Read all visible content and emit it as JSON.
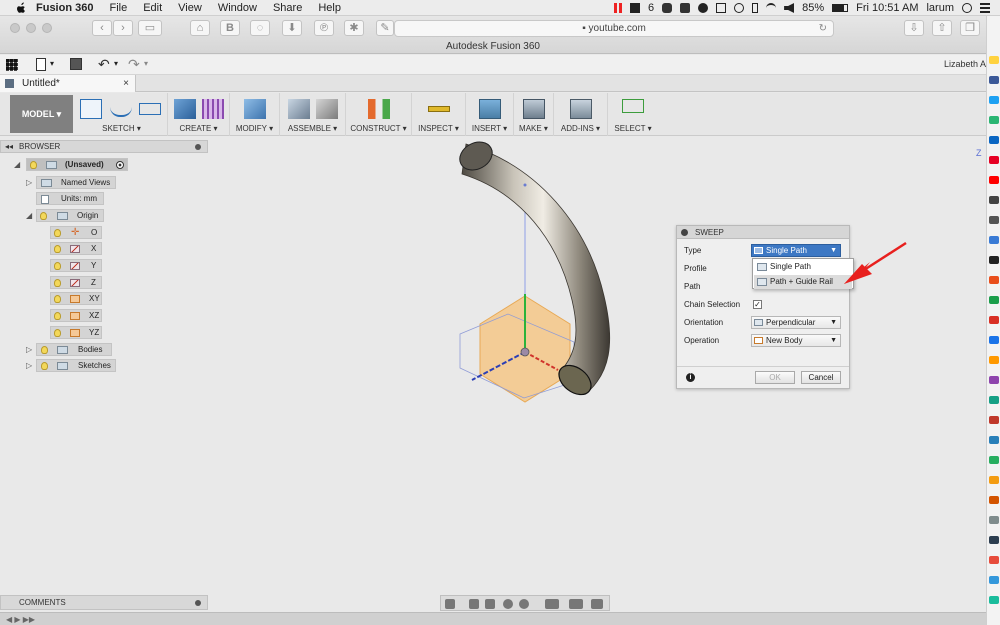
{
  "menubar": {
    "app_name": "Fusion 360",
    "menus": [
      "File",
      "Edit",
      "View",
      "Window",
      "Share",
      "Help"
    ],
    "notification_count": "6",
    "battery": "85%",
    "clock": "Fri 10:51 AM",
    "user": "larum"
  },
  "safari": {
    "url": "youtube.com",
    "window_title": "Autodesk Fusion 360"
  },
  "appbar": {
    "user_name": "Lizabeth A"
  },
  "document": {
    "tab_title": "Untitled*",
    "close_glyph": "×"
  },
  "ribbon": {
    "workspace": "MODEL ▾",
    "groups": [
      "SKETCH ▾",
      "CREATE ▾",
      "MODIFY ▾",
      "ASSEMBLE ▾",
      "CONSTRUCT ▾",
      "INSPECT ▾",
      "INSERT ▾",
      "MAKE ▾",
      "ADD-INS ▾",
      "SELECT ▾"
    ]
  },
  "browser": {
    "title": "BROWSER",
    "root": "(Unsaved)",
    "named_views": "Named Views",
    "units": "Units: mm",
    "origin": "Origin",
    "origin_items": [
      "O",
      "X",
      "Y",
      "Z",
      "XY",
      "XZ",
      "YZ"
    ],
    "bodies": "Bodies",
    "sketches": "Sketches"
  },
  "sweep": {
    "title": "SWEEP",
    "type_label": "Type",
    "type_value": "Single Path",
    "profile_label": "Profile",
    "path_label": "Path",
    "chain_label": "Chain Selection",
    "chain_checked": "✓",
    "orientation_label": "Orientation",
    "orientation_value": "Perpendicular",
    "operation_label": "Operation",
    "operation_value": "New Body",
    "info": "i",
    "ok": "OK",
    "cancel": "Cancel"
  },
  "type_dropdown": {
    "options": [
      "Single Path",
      "Path + Guide Rail"
    ]
  },
  "viewcube": {
    "axis_label": "Z"
  },
  "bottom": {
    "comments": "COMMENTS"
  },
  "colors": {
    "selected_blue": "#3d78c4",
    "annotation_arrow": "#e8201e",
    "plane_orange": "#f5c27a",
    "axis_red": "#d0342c",
    "axis_green": "#2bb33a",
    "axis_blue": "#2c3fb5"
  }
}
